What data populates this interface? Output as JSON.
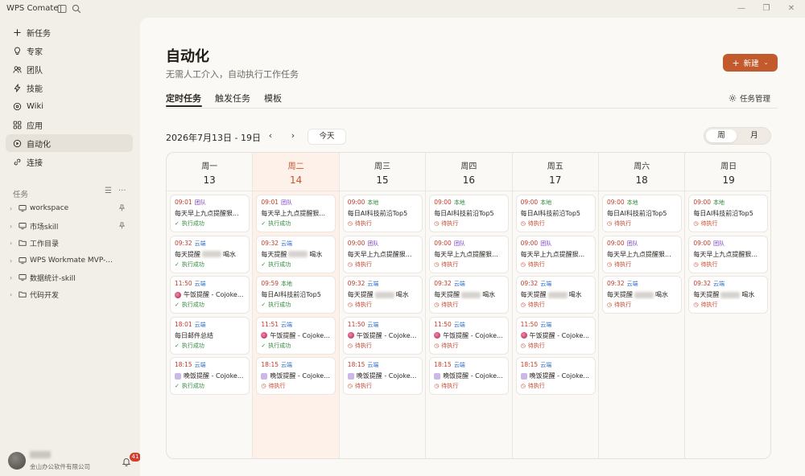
{
  "app": {
    "title": "WPS Comate"
  },
  "sidebar": {
    "items": [
      {
        "label": "新任务",
        "icon": "plus-icon"
      },
      {
        "label": "专家",
        "icon": "lightbulb-icon"
      },
      {
        "label": "团队",
        "icon": "team-icon"
      },
      {
        "label": "技能",
        "icon": "lightning-icon"
      },
      {
        "label": "Wiki",
        "icon": "wiki-icon"
      },
      {
        "label": "应用",
        "icon": "apps-icon"
      },
      {
        "label": "自动化",
        "icon": "automation-icon",
        "active": true
      },
      {
        "label": "连接",
        "icon": "link-icon"
      }
    ],
    "tasks_header": "任务",
    "tree": [
      {
        "label": "workspace",
        "pinned": true
      },
      {
        "label": "市场skill",
        "pinned": true
      },
      {
        "label": "工作目录",
        "pinned": false
      },
      {
        "label": "WPS Workmate MVP-...",
        "pinned": false
      },
      {
        "label": "数据统计-skill",
        "pinned": false
      },
      {
        "label": "代码开发",
        "pinned": false
      }
    ],
    "user": {
      "org": "金山办公软件有限公司"
    },
    "notifications": "41"
  },
  "main": {
    "title": "自动化",
    "subtitle": "无需人工介入，自动执行工作任务",
    "new_button": "新建",
    "tabs": [
      "定时任务",
      "触发任务",
      "模板"
    ],
    "task_management": "任务管理",
    "date_range": "2026年7月13日 - 19日",
    "today_button": "今天",
    "view_week": "周",
    "view_month": "月"
  },
  "calendar": {
    "days": [
      {
        "name": "周一",
        "num": "13",
        "today": false,
        "tasks": [
          {
            "time": "09:01",
            "tag": "团队",
            "tag_type": "team",
            "title": "每天早上九点提醒狠...",
            "status": "执行成功",
            "ok": true
          },
          {
            "time": "09:32",
            "tag": "云端",
            "tag_type": "cloud",
            "title_pre": "每天提醒",
            "title_post": "喝水",
            "blurred": true,
            "status": "执行成功",
            "ok": true
          },
          {
            "time": "11:50",
            "tag": "云端",
            "tag_type": "cloud",
            "title": "午饭提醒 - Cojoke...",
            "emoji": "lunch",
            "status": "执行成功",
            "ok": true
          },
          {
            "time": "18:01",
            "tag": "云端",
            "tag_type": "cloud",
            "title": "每日邮件总结",
            "status": "执行成功",
            "ok": true
          },
          {
            "time": "18:15",
            "tag": "云端",
            "tag_type": "cloud",
            "title": "晚饭提醒 - Cojoke...",
            "emoji": "dinner",
            "status": "执行成功",
            "ok": true
          }
        ]
      },
      {
        "name": "周二",
        "num": "14",
        "today": true,
        "tasks": [
          {
            "time": "09:01",
            "tag": "团队",
            "tag_type": "team",
            "title": "每天早上九点提醒狠...",
            "status": "执行成功",
            "ok": true
          },
          {
            "time": "09:32",
            "tag": "云端",
            "tag_type": "cloud",
            "title_pre": "每天提醒",
            "title_post": "喝水",
            "blurred": true,
            "status": "执行成功",
            "ok": true
          },
          {
            "time": "09:59",
            "tag": "本地",
            "tag_type": "local",
            "title": "每日AI科技前沿Top5",
            "status": "执行成功",
            "ok": true
          },
          {
            "time": "11:51",
            "tag": "云端",
            "tag_type": "cloud",
            "title": "午饭提醒 - Cojoke...",
            "emoji": "lunch",
            "status": "执行成功",
            "ok": true
          },
          {
            "time": "18:15",
            "tag": "云端",
            "tag_type": "cloud",
            "title": "晚饭提醒 - Cojoke...",
            "emoji": "dinner",
            "status": "待执行",
            "ok": false
          }
        ]
      },
      {
        "name": "周三",
        "num": "15",
        "today": false,
        "tasks": [
          {
            "time": "09:00",
            "tag": "本地",
            "tag_type": "local",
            "title": "每日AI科技前沿Top5",
            "status": "待执行",
            "ok": false
          },
          {
            "time": "09:00",
            "tag": "团队",
            "tag_type": "team",
            "title": "每天早上九点提醒狠...",
            "status": "待执行",
            "ok": false
          },
          {
            "time": "09:32",
            "tag": "云端",
            "tag_type": "cloud",
            "title_pre": "每天提醒",
            "title_post": "喝水",
            "blurred": true,
            "status": "待执行",
            "ok": false
          },
          {
            "time": "11:50",
            "tag": "云端",
            "tag_type": "cloud",
            "title": "午饭提醒 - Cojoke...",
            "emoji": "lunch",
            "status": "待执行",
            "ok": false
          },
          {
            "time": "18:15",
            "tag": "云端",
            "tag_type": "cloud",
            "title": "晚饭提醒 - Cojoke...",
            "emoji": "dinner",
            "status": "待执行",
            "ok": false
          }
        ]
      },
      {
        "name": "周四",
        "num": "16",
        "today": false,
        "tasks": [
          {
            "time": "09:00",
            "tag": "本地",
            "tag_type": "local",
            "title": "每日AI科技前沿Top5",
            "status": "待执行",
            "ok": false
          },
          {
            "time": "09:00",
            "tag": "团队",
            "tag_type": "team",
            "title": "每天早上九点提醒狠...",
            "status": "待执行",
            "ok": false
          },
          {
            "time": "09:32",
            "tag": "云端",
            "tag_type": "cloud",
            "title_pre": "每天提醒",
            "title_post": "喝水",
            "blurred": true,
            "status": "待执行",
            "ok": false
          },
          {
            "time": "11:50",
            "tag": "云端",
            "tag_type": "cloud",
            "title": "午饭提醒 - Cojoke...",
            "emoji": "lunch",
            "status": "待执行",
            "ok": false
          },
          {
            "time": "18:15",
            "tag": "云端",
            "tag_type": "cloud",
            "title": "晚饭提醒 - Cojoke...",
            "emoji": "dinner",
            "status": "待执行",
            "ok": false
          }
        ]
      },
      {
        "name": "周五",
        "num": "17",
        "today": false,
        "tasks": [
          {
            "time": "09:00",
            "tag": "本地",
            "tag_type": "local",
            "title": "每日AI科技前沿Top5",
            "status": "待执行",
            "ok": false
          },
          {
            "time": "09:00",
            "tag": "团队",
            "tag_type": "team",
            "title": "每天早上九点提醒狠...",
            "status": "待执行",
            "ok": false
          },
          {
            "time": "09:32",
            "tag": "云端",
            "tag_type": "cloud",
            "title_pre": "每天提醒",
            "title_post": "喝水",
            "blurred": true,
            "status": "待执行",
            "ok": false
          },
          {
            "time": "11:50",
            "tag": "云端",
            "tag_type": "cloud",
            "title": "午饭提醒 - Cojoke...",
            "emoji": "lunch",
            "status": "待执行",
            "ok": false
          },
          {
            "time": "18:15",
            "tag": "云端",
            "tag_type": "cloud",
            "title": "晚饭提醒 - Cojoke...",
            "emoji": "dinner",
            "status": "待执行",
            "ok": false
          }
        ]
      },
      {
        "name": "周六",
        "num": "18",
        "today": false,
        "tasks": [
          {
            "time": "09:00",
            "tag": "本地",
            "tag_type": "local",
            "title": "每日AI科技前沿Top5",
            "status": "待执行",
            "ok": false
          },
          {
            "time": "09:00",
            "tag": "团队",
            "tag_type": "team",
            "title": "每天早上九点提醒狠...",
            "status": "待执行",
            "ok": false
          },
          {
            "time": "09:32",
            "tag": "云端",
            "tag_type": "cloud",
            "title_pre": "每天提醒",
            "title_post": "喝水",
            "blurred": true,
            "status": "待执行",
            "ok": false
          }
        ]
      },
      {
        "name": "周日",
        "num": "19",
        "today": false,
        "tasks": [
          {
            "time": "09:00",
            "tag": "本地",
            "tag_type": "local",
            "title": "每日AI科技前沿Top5",
            "status": "待执行",
            "ok": false
          },
          {
            "time": "09:00",
            "tag": "团队",
            "tag_type": "team",
            "title": "每天早上九点提醒狠...",
            "status": "待执行",
            "ok": false
          },
          {
            "time": "09:32",
            "tag": "云端",
            "tag_type": "cloud",
            "title_pre": "每天提醒",
            "title_post": "喝水",
            "blurred": true,
            "status": "待执行",
            "ok": false
          }
        ]
      }
    ]
  },
  "colors": {
    "accent": "#c25a2e",
    "today_bg": "#fdf1ea",
    "ok": "#2e8b3c",
    "wait": "#c8452e"
  }
}
